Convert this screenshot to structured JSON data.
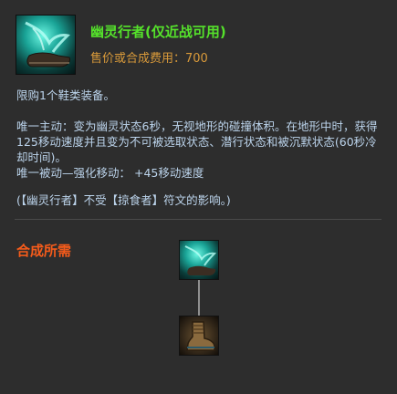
{
  "item": {
    "name": "幽灵行者(仅近战可用)",
    "price": "售价或合成费用：700",
    "icon": "ghost-boots-icon"
  },
  "description": {
    "line_limit": "限购1个鞋类装备。",
    "active": "唯一主动：变为幽灵状态6秒，无视地形的碰撞体积。在地形中时，获得125移动速度并且变为不可被选取状态、潜行状态和被沉默状态(60秒冷却时间)。",
    "passive": "唯一被动—强化移动：  +45移动速度",
    "note": "(【幽灵行者】不受【掠食者】符文的影响。)"
  },
  "recipe": {
    "title": "合成所需",
    "nodes": [
      {
        "icon": "ghost-boots-icon"
      },
      {
        "icon": "boots-of-speed-icon"
      }
    ]
  }
}
